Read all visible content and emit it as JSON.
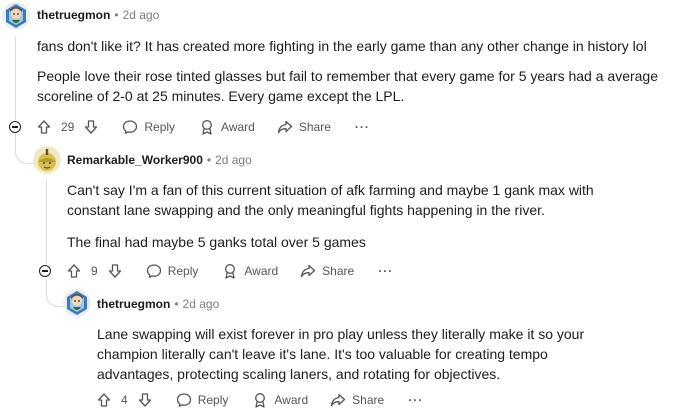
{
  "comments": [
    {
      "username": "thetruegmon",
      "time": "2d ago",
      "paragraphs": [
        "fans don't like it? It has created more fighting in the early game than any other change in history lol",
        "People love their rose tinted glasses but fail to remember that every game for 5 years had a average scoreline of 2-0 at 25 minutes. Every game except the LPL."
      ],
      "votes": "29",
      "reply_label": "Reply",
      "award_label": "Award",
      "share_label": "Share",
      "more_label": "···"
    },
    {
      "username": "Remarkable_Worker900",
      "time": "2d ago",
      "paragraphs": [
        "Can't say I'm a fan of this current situation of afk farming and maybe 1 gank max with constant lane swapping and the only meaningful fights happening in the river.",
        "The final had maybe 5 ganks total over 5 games"
      ],
      "votes": "9",
      "reply_label": "Reply",
      "award_label": "Award",
      "share_label": "Share",
      "more_label": "···"
    },
    {
      "username": "thetruegmon",
      "time": "2d ago",
      "paragraphs": [
        "Lane swapping will exist forever in pro play unless they literally make it so your champion literally can't leave it's lane. It's too valuable for creating tempo advantages, protecting scaling laners, and rotating for objectives."
      ],
      "votes": "4",
      "reply_label": "Reply",
      "award_label": "Award",
      "share_label": "Share",
      "more_label": "···"
    }
  ],
  "separator": "•",
  "colors": {
    "meta": "#7c7c7c",
    "text": "#1c1c1c",
    "thread": "#dadce0"
  }
}
